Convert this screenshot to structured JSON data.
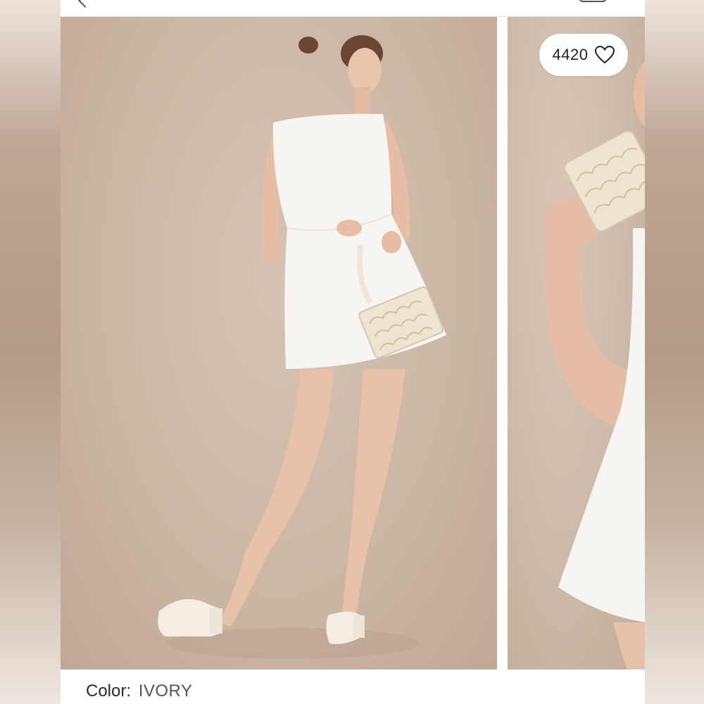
{
  "product": {
    "like_count": "4420",
    "color_label": "Color:",
    "color_value": "IVORY"
  },
  "gallery": {
    "images": [
      {
        "name": "model-full-length-photo"
      },
      {
        "name": "model-closeup-clutch-photo"
      }
    ]
  },
  "icons": {
    "like": "heart-icon",
    "back": "chevron-left-icon",
    "bag": "shopping-bag-icon"
  },
  "colors": {
    "photo_backdrop": "#ccb7a5",
    "dress": "#f7f5f2",
    "pill_bg": "#ffffff",
    "text": "#222222"
  }
}
